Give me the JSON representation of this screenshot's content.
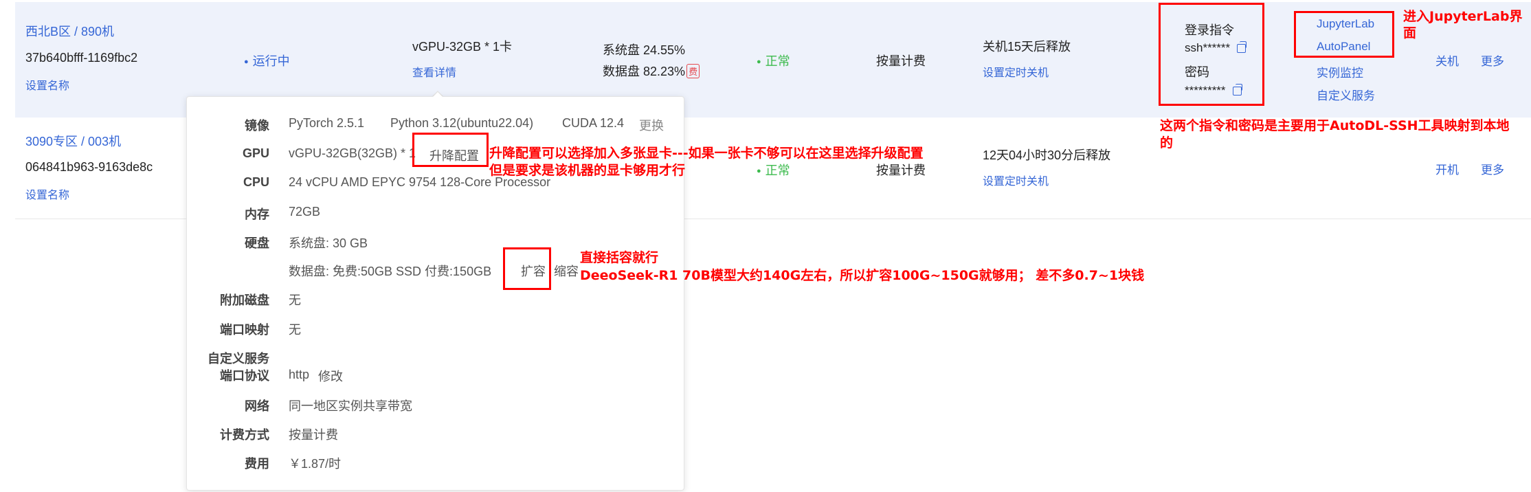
{
  "instances": [
    {
      "region": "西北B区 / 890机",
      "id": "37b640bfff-1169fbc2",
      "set_name": "设置名称",
      "status": "运行中",
      "gpu": "vGPU-32GB * 1卡",
      "details_link": "查看详情",
      "system_disk": "系统盘 24.55%",
      "data_disk": "数据盘 82.23%",
      "fee_badge": "费",
      "health": "正常",
      "billing": "按量计费",
      "shutdown_info": "关机15天后释放",
      "schedule_shutdown": "设置定时关机",
      "login_label": "登录指令",
      "login_cmd": "ssh******",
      "password_label": "密码",
      "password": "*********",
      "jupyter": "JupyterLab",
      "autopanel": "AutoPanel",
      "monitor": "实例监控",
      "custom_service": "自定义服务",
      "action_power": "关机",
      "action_more": "更多"
    },
    {
      "region": "3090专区 / 003机",
      "id": "064841b963-9163de8c",
      "set_name": "设置名称",
      "health": "正常",
      "billing": "按量计费",
      "shutdown_info": "12天04小时30分后释放",
      "schedule_shutdown": "设置定时关机",
      "action_power": "开机",
      "action_more": "更多"
    }
  ],
  "popup": {
    "image_label": "镜像",
    "image_pytorch": "PyTorch  2.5.1",
    "image_python": "Python  3.12(ubuntu22.04)",
    "image_cuda": "CUDA  12.4",
    "image_change": "更换",
    "gpu_label": "GPU",
    "gpu_value": "vGPU-32GB(32GB) * 1",
    "gpu_change": "升降配置",
    "cpu_label": "CPU",
    "cpu_value": "24 vCPU AMD EPYC 9754 128-Core Processor",
    "mem_label": "内存",
    "mem_value": "72GB",
    "disk_label": "硬盘",
    "disk_system": "系统盘:  30 GB",
    "disk_data": "数据盘:  免费:50GB SSD  付费:150GB",
    "disk_expand": "扩容",
    "disk_shrink": "缩容",
    "extra_disk_label": "附加磁盘",
    "extra_disk_value": "无",
    "port_map_label": "端口映射",
    "port_map_value": "无",
    "custom_service_label_1": "自定义服务",
    "custom_service_label_2": "端口协议",
    "custom_service_value": "http",
    "custom_service_edit": "修改",
    "network_label": "网络",
    "network_value": "同一地区实例共享带宽",
    "billing_label": "计费方式",
    "billing_value": "按量计费",
    "cost_label": "费用",
    "cost_value": "￥1.87/时"
  },
  "annotations": {
    "jupyter_1": "进入JupyterLab界",
    "jupyter_2": "面",
    "ssh_1": "这两个指令和密码是主要用于AutoDL-SSH工具映射到本地",
    "ssh_2": "的",
    "upgrade_1": "升降配置可以选择加入多张显卡---如果一张卡不够可以在这里选择升级配置",
    "upgrade_2": "但是要求是该机器的显卡够用才行",
    "expand_1": "直接括容就行",
    "expand_2": "DeeoSeek-R1 70B模型大约140G左右，所以扩容100G~150G就够用；   差不多0.7~1块钱"
  },
  "colors": {
    "link": "#3566d6",
    "ok": "#3dbb4e",
    "annotation": "#ff0000",
    "row_highlight": "#eef2fb"
  }
}
